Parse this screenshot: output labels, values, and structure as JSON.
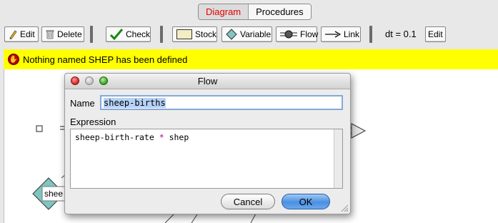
{
  "tabs": [
    {
      "label": "Diagram",
      "active": true
    },
    {
      "label": "Procedures",
      "active": false
    }
  ],
  "toolbar": {
    "edit": "Edit",
    "delete": "Delete",
    "check": "Check",
    "stock": "Stock",
    "variable": "Variable",
    "flow": "Flow",
    "link": "Link",
    "dt_label": "dt = 0.1",
    "dt_edit": "Edit"
  },
  "error": {
    "message": "Nothing named SHEP has been defined",
    "icon": "stop-hand-icon",
    "color": "#ffff00"
  },
  "canvas": {
    "variable_label": "shee"
  },
  "dialog": {
    "title": "Flow",
    "name_label": "Name",
    "name_value": "sheep-births",
    "expression_label": "Expression",
    "expression_parts": [
      "sheep-birth-rate",
      " * ",
      "shep"
    ],
    "cancel": "Cancel",
    "ok": "OK"
  },
  "colors": {
    "tab_active": "#e00000",
    "error_bg": "#ffff00",
    "ok_button": "#4c8fe0",
    "selection": "#b5d1f5"
  }
}
